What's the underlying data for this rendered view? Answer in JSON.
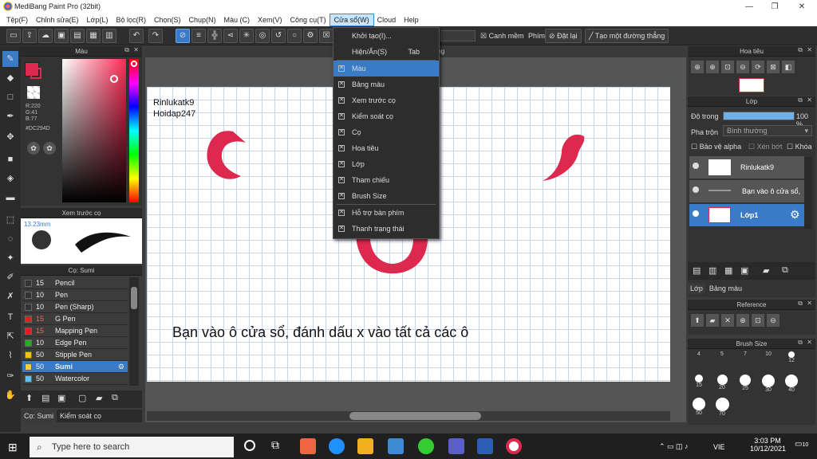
{
  "app": {
    "title": "MediBang Paint Pro (32bit)",
    "min": "—",
    "max": "❐",
    "close": "✕"
  },
  "menu": [
    "Tệp(F)",
    "Chỉnh sửa(E)",
    "Lớp(L)",
    "Bộ lọc(R)",
    "Chọn(S)",
    "Chụp(N)",
    "Màu (C)",
    "Xem(V)",
    "Công cụ(T)",
    "Cửa sổ(W)",
    "Cloud",
    "Help"
  ],
  "toolbar": {
    "canh_mem": "Canh mềm",
    "phim": "Phím",
    "dat_lai": "Đặt lại",
    "tao_duong_thang": "Tạo một đường thẳng"
  },
  "color_panel": {
    "title": "Màu",
    "r": "R:220",
    "g": "G:41",
    "b": "B:77",
    "hex": "#DC294D",
    "primary": "#dc294d"
  },
  "preview_panel": {
    "title": "Xem trước cọ",
    "size": "13.23mm"
  },
  "brush_panel": {
    "title": "Cọ: Sumi",
    "items": [
      {
        "size": "15",
        "name": "Pencil",
        "color": "#333333",
        "sel": false
      },
      {
        "size": "10",
        "name": "Pen",
        "color": "#333333",
        "sel": false
      },
      {
        "size": "10",
        "name": "Pen (Sharp)",
        "color": "#333333",
        "sel": false
      },
      {
        "size": "15",
        "name": "G Pen",
        "color": "#e02020",
        "sel": false
      },
      {
        "size": "15",
        "name": "Mapping Pen",
        "color": "#e02020",
        "sel": false
      },
      {
        "size": "10",
        "name": "Edge Pen",
        "color": "#20b020",
        "sel": false
      },
      {
        "size": "50",
        "name": "Stipple Pen",
        "color": "#f0c020",
        "sel": false
      },
      {
        "size": "50",
        "name": "Sumi",
        "color": "#f0d040",
        "sel": true
      },
      {
        "size": "50",
        "name": "Watercolor",
        "color": "#60c0f0",
        "sel": false
      }
    ],
    "tabs": [
      "Cọ: Sumi",
      "Kiểm soát cọ"
    ]
  },
  "document": {
    "tab": "Screenshot (36).png",
    "text1": "Rinlukatk9",
    "text2": "Hoidap247",
    "instruction": "Bạn vào ô cửa sổ, đánh dấu x vào tất cả các ô"
  },
  "window_menu": {
    "items": [
      {
        "label": "Khởi tạo(I)...",
        "check": false,
        "shortcut": ""
      },
      {
        "label": "Hiện/Ẩn(S)",
        "check": false,
        "shortcut": "Tab"
      },
      {
        "label": "Màu",
        "check": true,
        "shortcut": "",
        "sel": true
      },
      {
        "label": "Bảng màu",
        "check": true,
        "shortcut": ""
      },
      {
        "label": "Xem trước cọ",
        "check": true,
        "shortcut": ""
      },
      {
        "label": "Kiểm soát cọ",
        "check": true,
        "shortcut": ""
      },
      {
        "label": "Cọ",
        "check": true,
        "shortcut": ""
      },
      {
        "label": "Hoa tiêu",
        "check": true,
        "shortcut": ""
      },
      {
        "label": "Lớp",
        "check": true,
        "shortcut": ""
      },
      {
        "label": "Tham chiếu",
        "check": true,
        "shortcut": ""
      },
      {
        "label": "Brush Size",
        "check": true,
        "shortcut": ""
      },
      {
        "label": "Hỗ trợ bàn phím",
        "check": true,
        "shortcut": ""
      },
      {
        "label": "Thanh trạng thái",
        "check": true,
        "shortcut": ""
      }
    ]
  },
  "navigator": {
    "title": "Hoa tiêu"
  },
  "layer_panel": {
    "title": "Lớp",
    "opacity_label": "Độ trong",
    "opacity_value": "100 %",
    "blend_label": "Pha trộn",
    "blend_value": "Bình thường",
    "protect_alpha": "Bảo vệ alpha",
    "clipping": "Xén bớt",
    "lock": "Khóa",
    "layers": [
      {
        "name": "Rinlukatk9",
        "sel": false
      },
      {
        "name": "Bạn vào ô cửa sổ,",
        "sel": false
      },
      {
        "name": "Lớp1",
        "sel": true
      }
    ],
    "tabs": [
      "Lớp",
      "Bảng màu"
    ]
  },
  "reference": {
    "title": "Reference"
  },
  "brush_size": {
    "title": "Brush Size",
    "sizes": [
      "4",
      "5",
      "7",
      "10",
      "12",
      "15",
      "20",
      "25",
      "30",
      "40",
      "50",
      "70"
    ]
  },
  "taskbar": {
    "search": "Type here to search",
    "time": "3:03 PM",
    "date": "10/12/2021",
    "lang": "VIE",
    "notif": "10"
  }
}
